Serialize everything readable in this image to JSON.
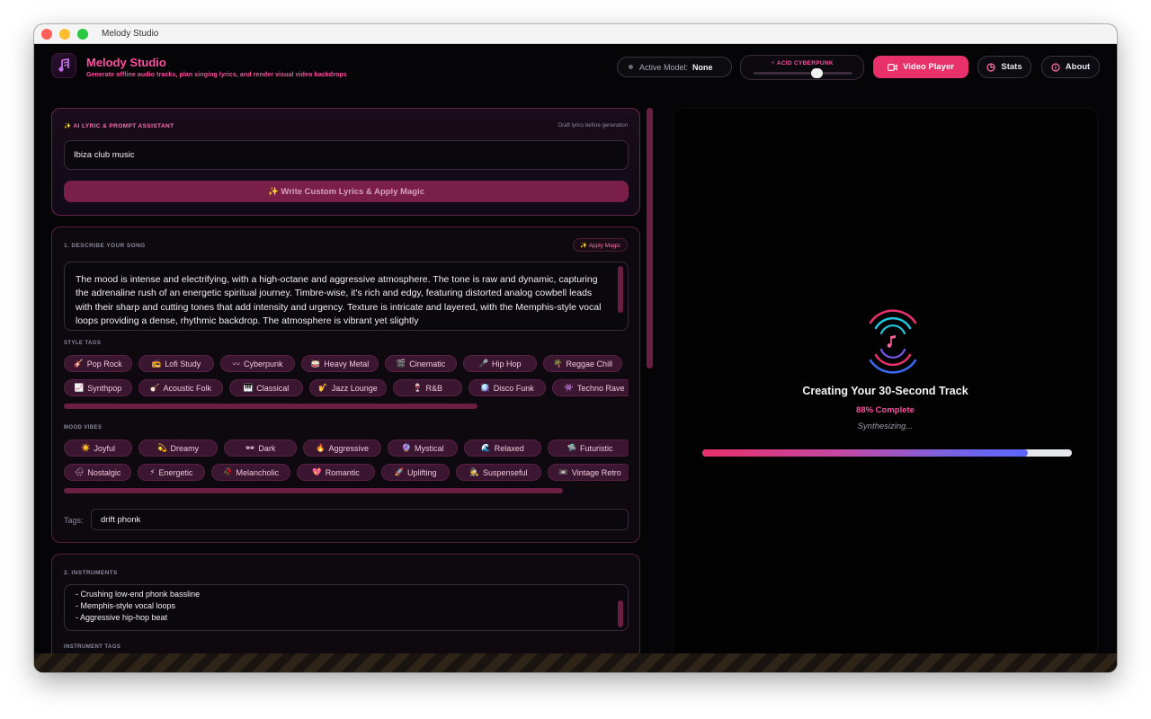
{
  "window": {
    "title": "Melody Studio"
  },
  "header": {
    "app_title": "Melody Studio",
    "subtitle": "Generate offline audio tracks, plan singing lyrics, and render visual video backdrops",
    "model_label": "Active Model:",
    "model_value": "None",
    "theme_label": "⚡ ACID CYBERPUNK",
    "video_button": "Video Player",
    "stats_button": "Stats",
    "about_button": "About"
  },
  "assistant": {
    "label": "✨ AI LYRIC & PROMPT ASSISTANT",
    "hint": "Draft lyrics before generation",
    "prompt_value": "Ibiza club music",
    "magic_button": "✨ Write Custom Lyrics & Apply Magic"
  },
  "describe": {
    "label": "1. DESCRIBE YOUR SONG",
    "apply_magic": "✨ Apply Magic",
    "description": "The mood is intense and electrifying, with a high-octane and aggressive atmosphere. The tone is raw and dynamic, capturing the adrenaline rush of an energetic spiritual journey. Timbre-wise, it's rich and edgy, featuring distorted analog cowbell leads with their sharp and cutting tones that add intensity and urgency. Texture is intricate and layered, with the Memphis-style vocal loops providing a dense, rhythmic backdrop. The atmosphere is vibrant yet slightly",
    "style_tags_label": "STYLE TAGS",
    "style_tags_row1": [
      {
        "icon": "🎸",
        "label": "Pop Rock"
      },
      {
        "icon": "📻",
        "label": "Lofi Study"
      },
      {
        "icon": "〰",
        "label": "Cyberpunk"
      },
      {
        "icon": "🥁",
        "label": "Heavy Metal"
      },
      {
        "icon": "🎬",
        "label": "Cinematic"
      },
      {
        "icon": "🎤",
        "label": "Hip Hop"
      },
      {
        "icon": "🌴",
        "label": "Reggae Chill"
      }
    ],
    "style_tags_row2": [
      {
        "icon": "📈",
        "label": "Synthpop"
      },
      {
        "icon": "🪕",
        "label": "Acoustic Folk"
      },
      {
        "icon": "🎹",
        "label": "Classical"
      },
      {
        "icon": "🎷",
        "label": "Jazz Lounge"
      },
      {
        "icon": "🍷",
        "label": "R&B"
      },
      {
        "icon": "🪩",
        "label": "Disco Funk"
      },
      {
        "icon": "👾",
        "label": "Techno Rave"
      }
    ],
    "mood_label": "MOOD VIBES",
    "mood_row1": [
      {
        "icon": "☀️",
        "label": "Joyful"
      },
      {
        "icon": "💫",
        "label": "Dreamy"
      },
      {
        "icon": "🕶",
        "label": "Dark"
      },
      {
        "icon": "🔥",
        "label": "Aggressive"
      },
      {
        "icon": "🔮",
        "label": "Mystical"
      },
      {
        "icon": "🌊",
        "label": "Relaxed"
      },
      {
        "icon": "🛸",
        "label": "Futuristic"
      }
    ],
    "mood_row2": [
      {
        "icon": "🌧",
        "label": "Nostalgic"
      },
      {
        "icon": "⚡",
        "label": "Energetic"
      },
      {
        "icon": "🥀",
        "label": "Melancholic"
      },
      {
        "icon": "💖",
        "label": "Romantic"
      },
      {
        "icon": "🚀",
        "label": "Uplifting"
      },
      {
        "icon": "🕵",
        "label": "Suspenseful"
      },
      {
        "icon": "📼",
        "label": "Vintage Retro"
      }
    ],
    "tags_label": "Tags:",
    "tags_value": "drift phonk"
  },
  "instruments": {
    "label": "2. INSTRUMENTS",
    "lines": [
      "- Crushing low-end phonk bassline",
      "- Memphis-style vocal loops",
      "- Aggressive hip-hop beat"
    ],
    "tags_label": "INSTRUMENT TAGS"
  },
  "generation": {
    "title": "Creating Your 30-Second Track",
    "percent_text": "88% Complete",
    "status": "Synthesizing...",
    "progress": 0.88
  },
  "colors": {
    "accent": "#ff4fa3",
    "primary_button": "#e8306a",
    "chip_bg": "#3a1630"
  }
}
